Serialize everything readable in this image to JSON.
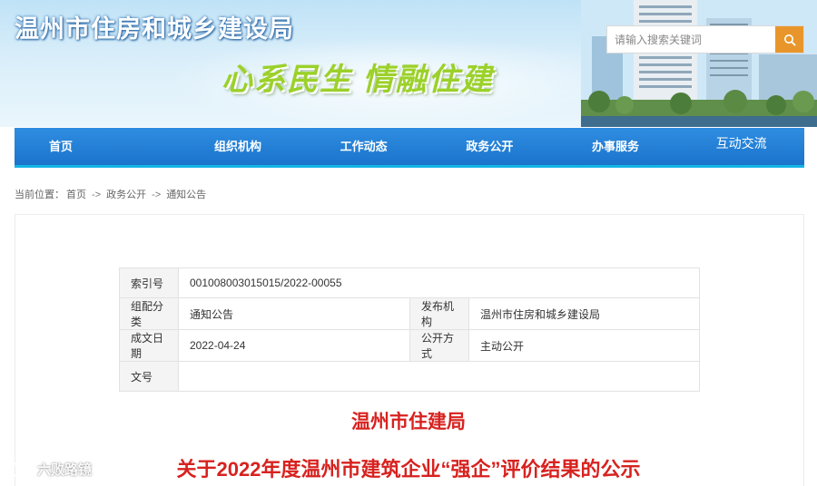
{
  "header": {
    "site_title": "温州市住房和城乡建设局",
    "slogan": "心系民生 情融住建",
    "search": {
      "placeholder": "请输入搜索关键词"
    }
  },
  "nav": {
    "items": [
      {
        "label": "首页"
      },
      {
        "label": "组织机构"
      },
      {
        "label": "工作动态"
      },
      {
        "label": "政务公开"
      },
      {
        "label": "办事服务"
      },
      {
        "label": "互动交流"
      }
    ]
  },
  "breadcrumb": {
    "prefix": "当前位置：",
    "items": [
      "首页",
      "政务公开",
      "通知公告"
    ],
    "separator": "->"
  },
  "info": {
    "index_label": "索引号",
    "index_value": "001008003015015/2022-00055",
    "category_label": "组配分类",
    "category_value": "通知公告",
    "publisher_label": "发布机构",
    "publisher_value": "温州市住房和城乡建设局",
    "date_label": "成文日期",
    "date_value": "2022-04-24",
    "open_label": "公开方式",
    "open_value": "主动公开",
    "docno_label": "文号",
    "docno_value": ""
  },
  "article": {
    "org": "温州市住建局",
    "title": "关于2022年度温州市建筑企业“强企”评价结果的公示"
  },
  "watermark": {
    "text": "六败路镜"
  },
  "colors": {
    "nav_blue": "#1f7fd6",
    "search_orange": "#e8962b",
    "title_red": "#d7221f",
    "slogan_green": "#9bd12a"
  }
}
